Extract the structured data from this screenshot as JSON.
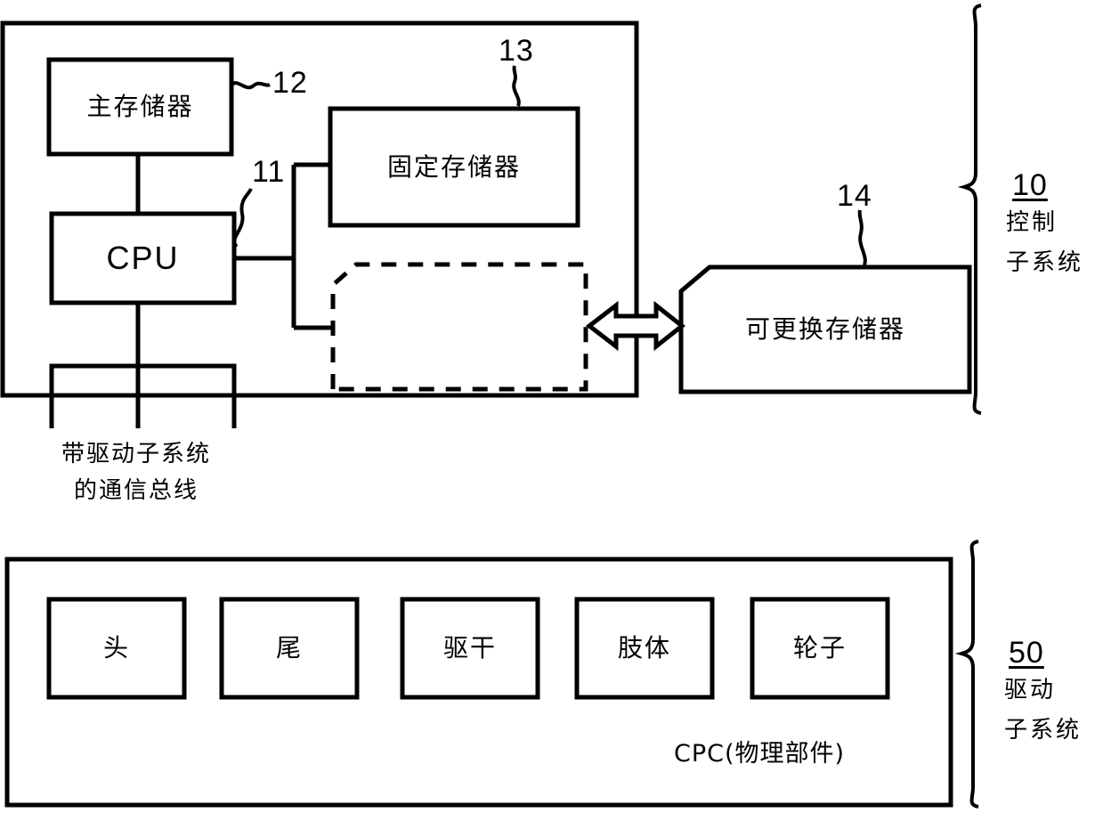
{
  "figure": {
    "title": "Control subsystem and drive subsystem block diagram",
    "stroke_color": "#000000",
    "background_color": "#ffffff"
  },
  "control_subsystem": {
    "ref_number": "10",
    "caption_line1": "控制",
    "caption_line2": "子系统",
    "blocks": {
      "main_memory": {
        "label": "主存储器",
        "ref_number": "12"
      },
      "cpu": {
        "label": "CPU",
        "ref_number": "11"
      },
      "fixed_memory": {
        "label": "固定存储器",
        "ref_number": "13"
      },
      "removable_memory": {
        "label": "可更换存储器",
        "ref_number": "14"
      },
      "dashed_region": {
        "label": ""
      }
    },
    "bus_caption_line1": "带驱动子系统",
    "bus_caption_line2": "的通信总线"
  },
  "drive_subsystem": {
    "ref_number": "50",
    "caption_line1": "驱动",
    "caption_line2": "子系统",
    "cpc_label": "CPC(物理部件)",
    "components": [
      {
        "label": "头"
      },
      {
        "label": "尾"
      },
      {
        "label": "驱干"
      },
      {
        "label": "肢体"
      },
      {
        "label": "轮子"
      }
    ]
  }
}
